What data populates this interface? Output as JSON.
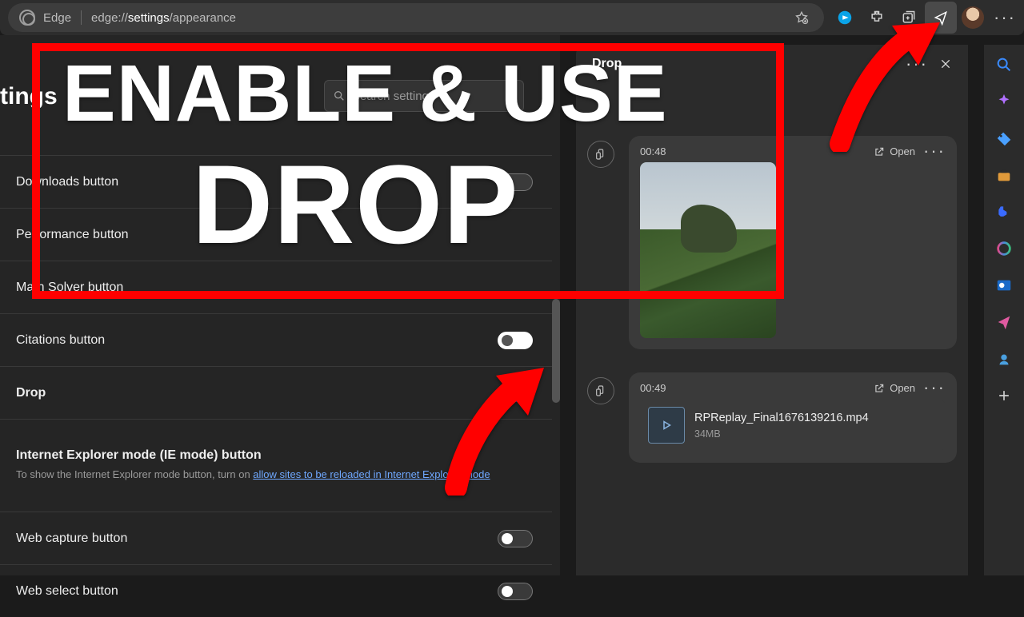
{
  "topbar": {
    "brand": "Edge",
    "url_prefix": "edge://",
    "url_hl": "settings",
    "url_suffix": "/appearance"
  },
  "settings": {
    "heading": "tings",
    "search_placeholder": "Search settings",
    "rows": [
      {
        "label": "Downloads button",
        "state": "hidden"
      },
      {
        "label": "Performance button",
        "state": "hidden"
      },
      {
        "label": "Math Solver button",
        "state": "hidden"
      },
      {
        "label": "Citations button",
        "state": "hidden"
      },
      {
        "label": "Drop",
        "state": "on"
      },
      {
        "label": "Internet Explorer mode (IE mode) button",
        "desc_a": "To show the Internet Explorer mode button, turn on ",
        "desc_link": "allow sites to be reloaded in Internet Explorer mode",
        "state": "hidden"
      },
      {
        "label": "Web capture button",
        "state": "off"
      },
      {
        "label": "Web select button",
        "state": "off"
      }
    ]
  },
  "drop": {
    "title": "Drop",
    "items": [
      {
        "kind": "image",
        "time": "00:48",
        "open": "Open"
      },
      {
        "kind": "file",
        "time": "00:49",
        "open": "Open",
        "file_name": "RPReplay_Final1676139216.mp4",
        "file_size": "34MB"
      }
    ]
  },
  "overlay": {
    "line1": "ENABLE & USE",
    "line2": "DROP"
  }
}
